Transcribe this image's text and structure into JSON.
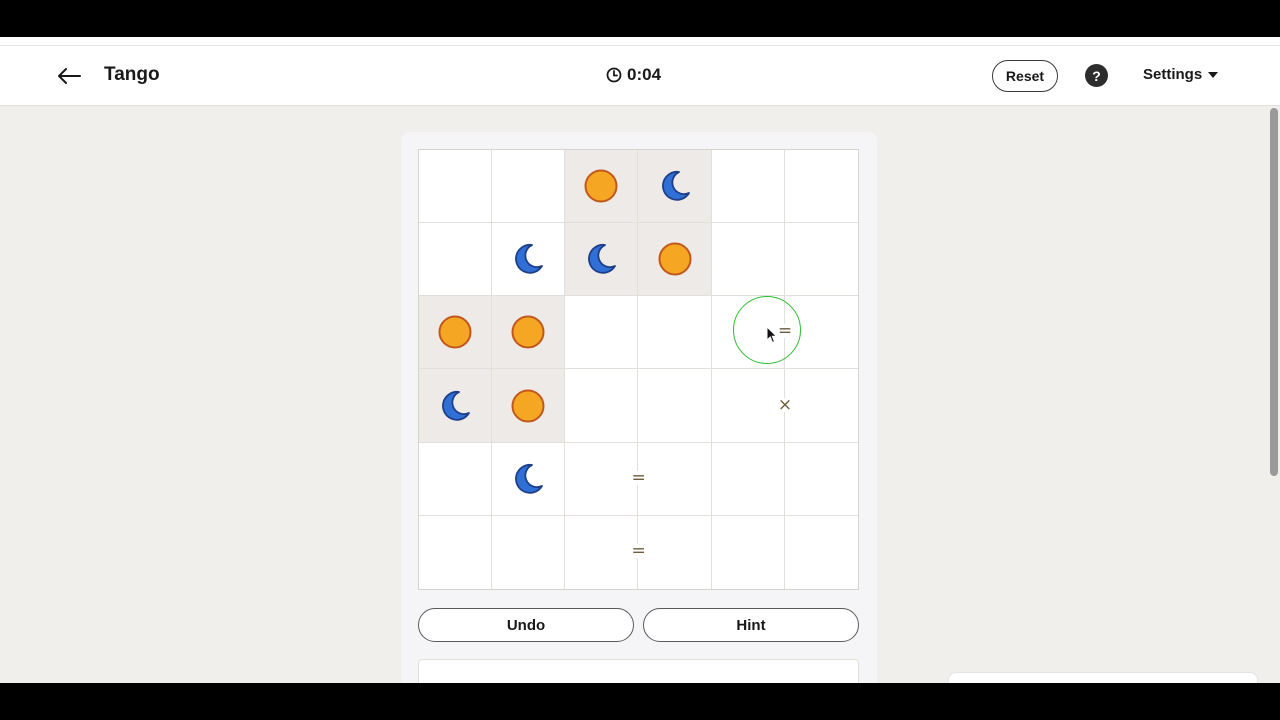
{
  "header": {
    "title": "Tango",
    "timer": "0:04",
    "reset_label": "Reset",
    "help_label": "?",
    "settings_label": "Settings"
  },
  "actions": {
    "undo_label": "Undo",
    "hint_label": "Hint"
  },
  "board": {
    "size": 6,
    "cells": [
      [
        null,
        null,
        "sun",
        "moon",
        null,
        null
      ],
      [
        null,
        "moon",
        "moon",
        "sun",
        null,
        null
      ],
      [
        "sun",
        "sun",
        null,
        null,
        null,
        null
      ],
      [
        "moon",
        "sun",
        null,
        null,
        null,
        null
      ],
      [
        null,
        "moon",
        null,
        null,
        null,
        null
      ],
      [
        null,
        null,
        null,
        null,
        null,
        null
      ]
    ],
    "prefilled": [
      [
        false,
        false,
        true,
        true,
        false,
        false
      ],
      [
        false,
        false,
        true,
        true,
        false,
        false
      ],
      [
        true,
        true,
        false,
        false,
        false,
        false
      ],
      [
        true,
        true,
        false,
        false,
        false,
        false
      ],
      [
        false,
        false,
        false,
        false,
        false,
        false
      ],
      [
        false,
        false,
        false,
        false,
        false,
        false
      ]
    ],
    "constraints": [
      {
        "row": 2,
        "col": 4,
        "side": "right",
        "symbol": "="
      },
      {
        "row": 3,
        "col": 4,
        "side": "right",
        "symbol": "×"
      },
      {
        "row": 4,
        "col": 2,
        "side": "right",
        "symbol": "="
      },
      {
        "row": 5,
        "col": 2,
        "side": "right",
        "symbol": "="
      }
    ]
  },
  "colors": {
    "sun_fill": "#f5a623",
    "sun_stroke": "#c1581b",
    "moon_fill": "#2f6fd6",
    "moon_stroke": "#1d3f8a",
    "prefilled_bg": "#eeeae7",
    "click_ring": "#2fbd32"
  },
  "icons": {
    "back": "arrow-left-icon",
    "timer": "clock-icon",
    "help": "question-icon",
    "settings": "chevron-down-icon",
    "sun": "sun-icon",
    "moon": "moon-icon"
  }
}
